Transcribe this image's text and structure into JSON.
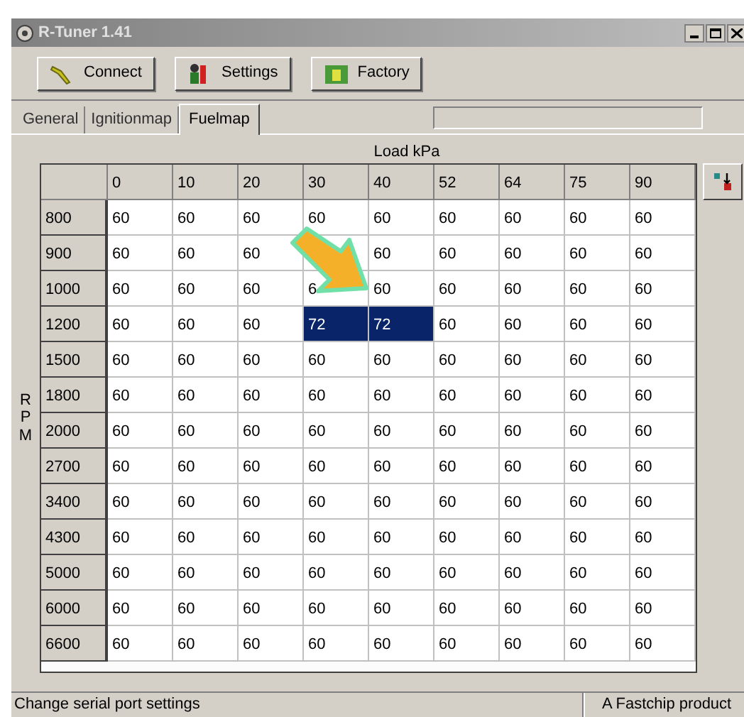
{
  "window": {
    "title": "R-Tuner 1.41"
  },
  "toolbar": [
    {
      "label": "Connect",
      "kind": "connect"
    },
    {
      "label": "Settings",
      "kind": "settings"
    },
    {
      "label": "Factory",
      "kind": "factory"
    }
  ],
  "tabs": [
    {
      "label": "General",
      "selected": false
    },
    {
      "label": "Ignitionmap",
      "selected": false
    },
    {
      "label": "Fuelmap",
      "selected": true
    }
  ],
  "table": {
    "x_axis_label": "Load kPa",
    "y_axis_label": "RPM",
    "columns": [
      "0",
      "10",
      "20",
      "30",
      "40",
      "52",
      "64",
      "75",
      "90"
    ],
    "rows": [
      {
        "rpm": "800",
        "cells": [
          {
            "text": "60",
            "selected": false
          },
          {
            "text": "60",
            "selected": false
          },
          {
            "text": "60",
            "selected": false
          },
          {
            "text": "60",
            "selected": false
          },
          {
            "text": "60",
            "selected": false
          },
          {
            "text": "60",
            "selected": false
          },
          {
            "text": "60",
            "selected": false
          },
          {
            "text": "60",
            "selected": false
          },
          {
            "text": "60",
            "selected": false
          }
        ]
      },
      {
        "rpm": "900",
        "cells": [
          {
            "text": "60",
            "selected": false
          },
          {
            "text": "60",
            "selected": false
          },
          {
            "text": "60",
            "selected": false
          },
          {},
          {
            "text": "60",
            "selected": false
          },
          {
            "text": "60",
            "selected": false
          },
          {
            "text": "60",
            "selected": false
          },
          {
            "text": "60",
            "selected": false
          },
          {
            "text": "60",
            "selected": false
          }
        ]
      },
      {
        "rpm": "1000",
        "cells": [
          {
            "text": "60",
            "selected": false
          },
          {
            "text": "60",
            "selected": false
          },
          {
            "text": "60",
            "selected": false
          },
          {
            "text": "6",
            "selected": false
          },
          {
            "text": "60",
            "selected": false
          },
          {
            "text": "60",
            "selected": false
          },
          {
            "text": "60",
            "selected": false
          },
          {
            "text": "60",
            "selected": false
          },
          {
            "text": "60",
            "selected": false
          }
        ]
      },
      {
        "rpm": "1200",
        "cells": [
          {
            "text": "60",
            "selected": false
          },
          {
            "text": "60",
            "selected": false
          },
          {
            "text": "60",
            "selected": false
          },
          {
            "text": "72",
            "selected": true
          },
          {
            "text": "72",
            "selected": true
          },
          {
            "text": "60",
            "selected": false
          },
          {
            "text": "60",
            "selected": false
          },
          {
            "text": "60",
            "selected": false
          },
          {
            "text": "60",
            "selected": false
          }
        ]
      },
      {
        "rpm": "1500",
        "cells": [
          {
            "text": "60",
            "selected": false
          },
          {
            "text": "60",
            "selected": false
          },
          {
            "text": "60",
            "selected": false
          },
          {
            "text": "60",
            "selected": false
          },
          {
            "text": "60",
            "selected": false
          },
          {
            "text": "60",
            "selected": false
          },
          {
            "text": "60",
            "selected": false
          },
          {
            "text": "60",
            "selected": false
          },
          {
            "text": "60",
            "selected": false
          }
        ]
      },
      {
        "rpm": "1800",
        "cells": [
          {
            "text": "60",
            "selected": false
          },
          {
            "text": "60",
            "selected": false
          },
          {
            "text": "60",
            "selected": false
          },
          {
            "text": "60",
            "selected": false
          },
          {
            "text": "60",
            "selected": false
          },
          {
            "text": "60",
            "selected": false
          },
          {
            "text": "60",
            "selected": false
          },
          {
            "text": "60",
            "selected": false
          },
          {
            "text": "60",
            "selected": false
          }
        ]
      },
      {
        "rpm": "2000",
        "cells": [
          {
            "text": "60",
            "selected": false
          },
          {
            "text": "60",
            "selected": false
          },
          {
            "text": "60",
            "selected": false
          },
          {
            "text": "60",
            "selected": false
          },
          {
            "text": "60",
            "selected": false
          },
          {
            "text": "60",
            "selected": false
          },
          {
            "text": "60",
            "selected": false
          },
          {
            "text": "60",
            "selected": false
          },
          {
            "text": "60",
            "selected": false
          }
        ]
      },
      {
        "rpm": "2700",
        "cells": [
          {
            "text": "60",
            "selected": false
          },
          {
            "text": "60",
            "selected": false
          },
          {
            "text": "60",
            "selected": false
          },
          {
            "text": "60",
            "selected": false
          },
          {
            "text": "60",
            "selected": false
          },
          {
            "text": "60",
            "selected": false
          },
          {
            "text": "60",
            "selected": false
          },
          {
            "text": "60",
            "selected": false
          },
          {
            "text": "60",
            "selected": false
          }
        ]
      },
      {
        "rpm": "3400",
        "cells": [
          {
            "text": "60",
            "selected": false
          },
          {
            "text": "60",
            "selected": false
          },
          {
            "text": "60",
            "selected": false
          },
          {
            "text": "60",
            "selected": false
          },
          {
            "text": "60",
            "selected": false
          },
          {
            "text": "60",
            "selected": false
          },
          {
            "text": "60",
            "selected": false
          },
          {
            "text": "60",
            "selected": false
          },
          {
            "text": "60",
            "selected": false
          }
        ]
      },
      {
        "rpm": "4300",
        "cells": [
          {
            "text": "60",
            "selected": false
          },
          {
            "text": "60",
            "selected": false
          },
          {
            "text": "60",
            "selected": false
          },
          {
            "text": "60",
            "selected": false
          },
          {
            "text": "60",
            "selected": false
          },
          {
            "text": "60",
            "selected": false
          },
          {
            "text": "60",
            "selected": false
          },
          {
            "text": "60",
            "selected": false
          },
          {
            "text": "60",
            "selected": false
          }
        ]
      },
      {
        "rpm": "5000",
        "cells": [
          {
            "text": "60",
            "selected": false
          },
          {
            "text": "60",
            "selected": false
          },
          {
            "text": "60",
            "selected": false
          },
          {
            "text": "60",
            "selected": false
          },
          {
            "text": "60",
            "selected": false
          },
          {
            "text": "60",
            "selected": false
          },
          {
            "text": "60",
            "selected": false
          },
          {
            "text": "60",
            "selected": false
          },
          {
            "text": "60",
            "selected": false
          }
        ]
      },
      {
        "rpm": "6000",
        "cells": [
          {
            "text": "60",
            "selected": false
          },
          {
            "text": "60",
            "selected": false
          },
          {
            "text": "60",
            "selected": false
          },
          {
            "text": "60",
            "selected": false
          },
          {
            "text": "60",
            "selected": false
          },
          {
            "text": "60",
            "selected": false
          },
          {
            "text": "60",
            "selected": false
          },
          {
            "text": "60",
            "selected": false
          },
          {
            "text": "60",
            "selected": false
          }
        ]
      },
      {
        "rpm": "6600",
        "cells": [
          {
            "text": "60",
            "selected": false
          },
          {
            "text": "60",
            "selected": false
          },
          {
            "text": "60",
            "selected": false
          },
          {
            "text": "60",
            "selected": false
          },
          {
            "text": "60",
            "selected": false
          },
          {
            "text": "60",
            "selected": false
          },
          {
            "text": "60",
            "selected": false
          },
          {
            "text": "60",
            "selected": false
          },
          {
            "text": "60",
            "selected": false
          }
        ]
      }
    ]
  },
  "status_bar": {
    "message": "Change serial port settings",
    "credit": "A Fastchip product"
  }
}
